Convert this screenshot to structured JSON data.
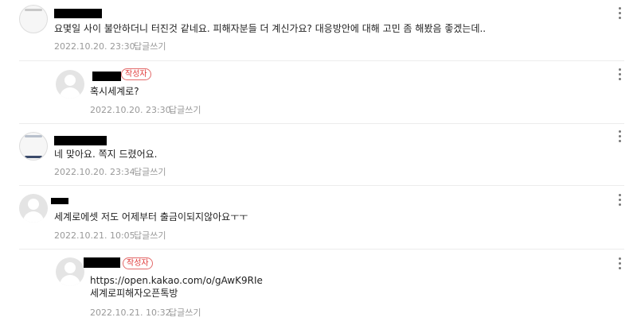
{
  "comments": [
    {
      "author_badge": "",
      "lines": [
        "요몇일 사이 불안하더니 터진것 같네요. 피해자분들 더 계신가요? 대응방안에 대해 고민 좀 해봤음 좋겠는데.."
      ],
      "date": "2022.10.20. 23:30",
      "reply_label": "답글쓰기"
    },
    {
      "author_badge": "작성자",
      "lines": [
        "혹시세계로?"
      ],
      "date": "2022.10.20. 23:30",
      "reply_label": "답글쓰기"
    },
    {
      "author_badge": "",
      "lines": [
        "네 맞아요. 쪽지 드렸어요."
      ],
      "date": "2022.10.20. 23:34",
      "reply_label": "답글쓰기"
    },
    {
      "author_badge": "",
      "lines": [
        "세계로에셋 저도 어제부터 출금이되지않아요ㅜㅜ"
      ],
      "date": "2022.10.21. 10:05",
      "reply_label": "답글쓰기"
    },
    {
      "author_badge": "작성자",
      "lines": [
        "https://open.kakao.com/o/gAwK9RIe",
        "세계로피해자오픈톡방"
      ],
      "date": "2022.10.21. 10:32",
      "reply_label": "답글쓰기"
    }
  ],
  "icons": {
    "more": "more-vertical-icon",
    "avatar": "default-profile-icon"
  },
  "colors": {
    "author_badge": "#e03c3c",
    "meta_text": "#999999"
  }
}
